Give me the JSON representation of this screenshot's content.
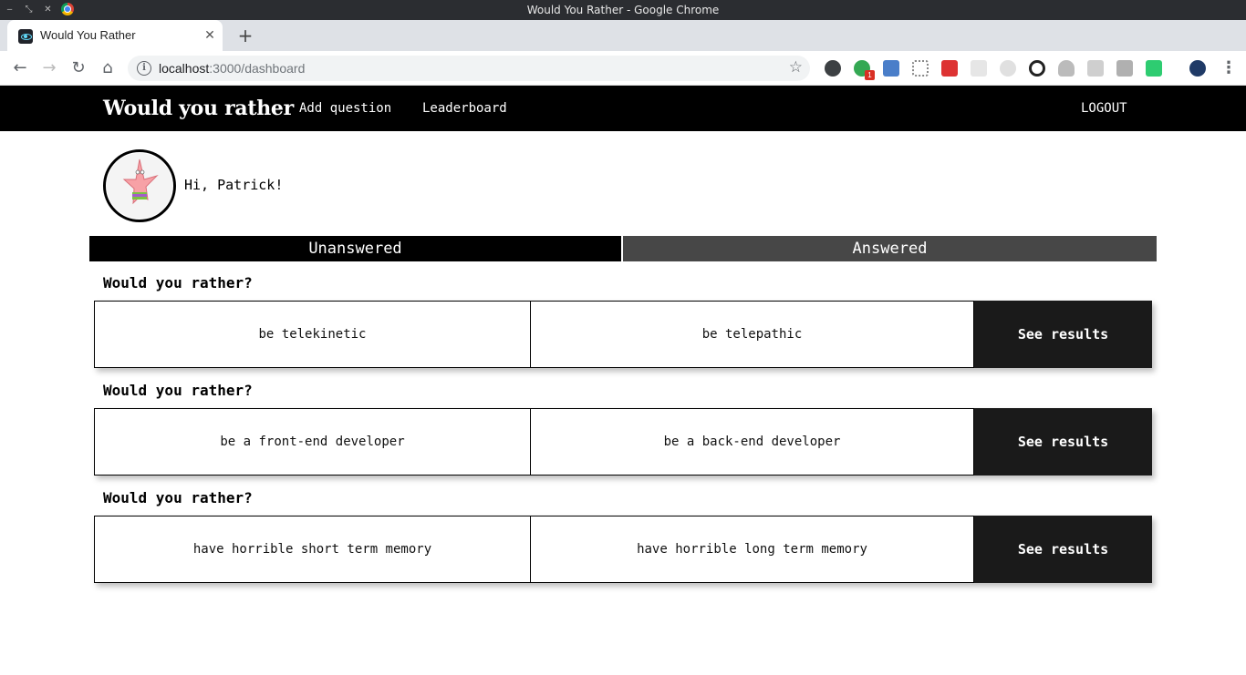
{
  "window": {
    "title": "Would You Rather - Google Chrome"
  },
  "browser": {
    "tab_title": "Would You Rather",
    "url_host": "localhost",
    "url_path": ":3000/dashboard",
    "ext_badge": "1"
  },
  "app": {
    "brand": "Would you rather",
    "nav": {
      "add_question": "Add question",
      "leaderboard": "Leaderboard",
      "logout": "LOGOUT"
    },
    "greeting": "Hi, Patrick!",
    "tabs": {
      "unanswered": "Unanswered",
      "answered": "Answered"
    },
    "questions": [
      {
        "title": "Would you rather?",
        "option_one": "be telekinetic",
        "option_two": "be telepathic",
        "action": "See results"
      },
      {
        "title": "Would you rather?",
        "option_one": "be a front-end developer",
        "option_two": "be a back-end developer",
        "action": "See results"
      },
      {
        "title": "Would you rather?",
        "option_one": "have horrible short term memory",
        "option_two": "have horrible long term memory",
        "action": "See results"
      }
    ]
  },
  "colors": {
    "nav_bg": "#000000",
    "active_tab": "#000000",
    "inactive_tab": "#474747",
    "results_button": "#1a1a1a"
  }
}
